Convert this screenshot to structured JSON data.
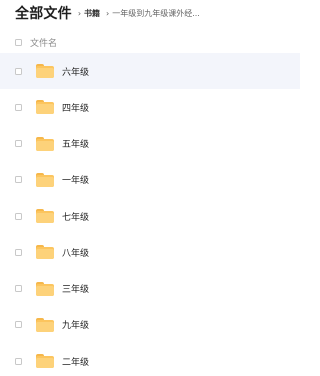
{
  "breadcrumb": {
    "root": "全部文件",
    "sep1": "›",
    "middle": "书籍",
    "sep2": "›",
    "current": "一年级到九年级课外经..."
  },
  "list_header": {
    "column_label": "文件名"
  },
  "folders": [
    {
      "name": "六年级"
    },
    {
      "name": "四年级"
    },
    {
      "name": "五年级"
    },
    {
      "name": "一年级"
    },
    {
      "name": "七年级"
    },
    {
      "name": "八年级"
    },
    {
      "name": "三年级"
    },
    {
      "name": "九年级"
    },
    {
      "name": "二年级"
    }
  ],
  "colors": {
    "folder": "#fcc55e",
    "row_highlight": "#f3f5fb"
  },
  "icons": {
    "row_icon": "folder-icon",
    "checkbox": "checkbox-icon"
  }
}
